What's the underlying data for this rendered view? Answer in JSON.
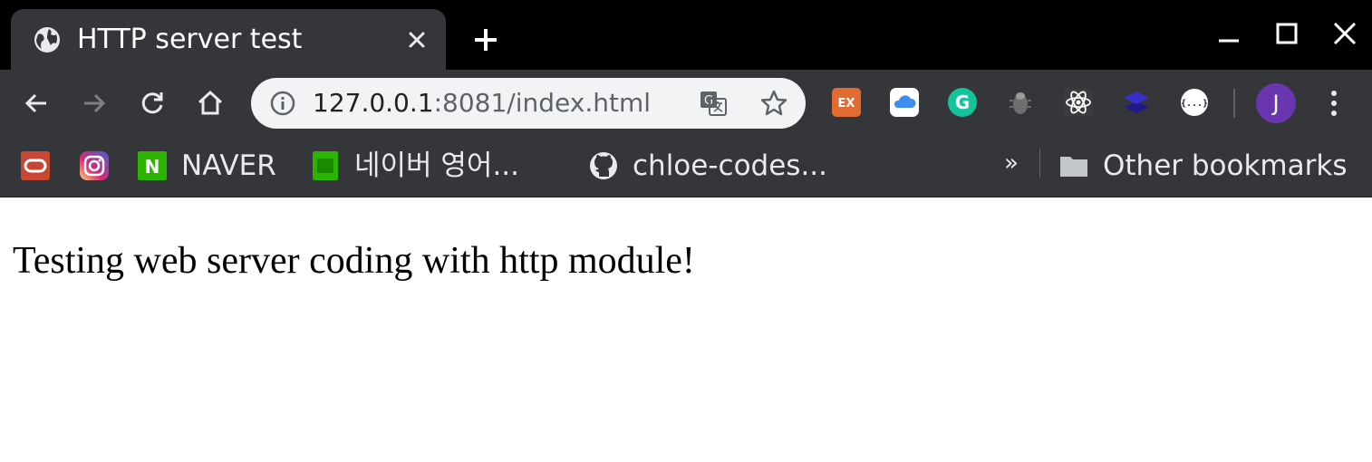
{
  "tab": {
    "title": "HTTP server test",
    "icon": "globe-icon"
  },
  "toolbar": {
    "url_host": "127.0.0.1",
    "url_rest": ":8081/index.html"
  },
  "extensions": [
    {
      "name": "ex-extension-icon",
      "label": "EX",
      "color": "#e26b32"
    },
    {
      "name": "icloud-extension-icon",
      "color": "#ffffff"
    },
    {
      "name": "grammarly-extension-icon",
      "label": "G",
      "color": "#15c39a"
    },
    {
      "name": "bug-extension-icon",
      "color": "#8a8a8a"
    },
    {
      "name": "react-devtools-icon",
      "color": "#61dafb"
    },
    {
      "name": "layers-extension-icon",
      "color": "#3b2fc9"
    },
    {
      "name": "json-viewer-icon",
      "label": "{...}",
      "color": "#ffffff"
    }
  ],
  "avatar": {
    "initial": "J",
    "color": "#6a36b0"
  },
  "bookmarks": {
    "items": [
      {
        "label": ""
      },
      {
        "label": ""
      },
      {
        "label": "NAVER"
      },
      {
        "label": "네이버 영어..."
      },
      {
        "label": "chloe-codes..."
      }
    ],
    "overflow": "»",
    "other": "Other bookmarks"
  },
  "page": {
    "text": "Testing web server coding with http module!"
  }
}
